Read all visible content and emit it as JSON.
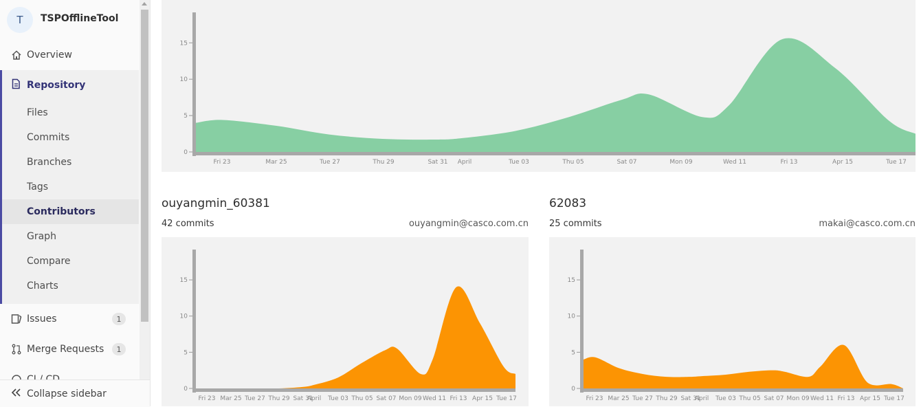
{
  "project": {
    "avatar_letter": "T",
    "name": "TSPOfflineTool"
  },
  "nav": {
    "overview": "Overview",
    "repository": "Repository",
    "repository_items": [
      "Files",
      "Commits",
      "Branches",
      "Tags",
      "Contributors",
      "Graph",
      "Compare",
      "Charts"
    ],
    "active_item": "Contributors",
    "issues": {
      "label": "Issues",
      "count": "1"
    },
    "merge_requests": {
      "label": "Merge Requests",
      "count": "1"
    },
    "cicd": "CI / CD",
    "collapse": "Collapse sidebar"
  },
  "colors": {
    "total_fill": "#87cfa3",
    "contrib_fill": "#fc9403",
    "accent": "#4b4ba3"
  },
  "chart_data": [
    {
      "type": "area",
      "title": "",
      "x_ticks": [
        "Fri 23",
        "Mar 25",
        "Tue 27",
        "Thu 29",
        "Sat 31",
        "April",
        "Tue 03",
        "Thu 05",
        "Sat 07",
        "Mon 09",
        "Wed 11",
        "Fri 13",
        "Apr 15",
        "Tue 17"
      ],
      "y_ticks": [
        "0",
        "5",
        "10",
        "15"
      ],
      "ylim": [
        0,
        19
      ],
      "x": [
        "Mar 22",
        "Mar 23",
        "Mar 25",
        "Mar 27",
        "Mar 29",
        "Mar 31",
        "Apr 01",
        "Apr 03",
        "Apr 05",
        "Apr 07",
        "Apr 08",
        "Apr 10",
        "Apr 11",
        "Apr 13",
        "Apr 15",
        "Apr 17",
        "Apr 18"
      ],
      "values": [
        4,
        4.4,
        3.6,
        2.4,
        1.8,
        1.7,
        1.9,
        2.9,
        4.8,
        7.2,
        7.9,
        4.8,
        6.4,
        15.5,
        11.5,
        4.3,
        2.5
      ]
    },
    {
      "type": "area",
      "author": "ouyangmin_60381",
      "commits": "42 commits",
      "email": "ouyangmin@casco.com.cn",
      "x_ticks": [
        "Fri 23",
        "Mar 25",
        "Tue 27",
        "Thu 29",
        "Sat 31",
        "April",
        "Tue 03",
        "Thu 05",
        "Sat 07",
        "Mon 09",
        "Wed 11",
        "Fri 13",
        "Apr 15",
        "Tue 17"
      ],
      "y_ticks": [
        "0",
        "5",
        "10",
        "15"
      ],
      "ylim": [
        0,
        19
      ],
      "x": [
        "Mar 22",
        "Mar 23",
        "Mar 25",
        "Mar 27",
        "Mar 29",
        "Mar 31",
        "Apr 01",
        "Apr 03",
        "Apr 05",
        "Apr 07",
        "Apr 08",
        "Apr 10",
        "Apr 11",
        "Apr 13",
        "Apr 15",
        "Apr 17",
        "Apr 18"
      ],
      "values": [
        0,
        0,
        0,
        0,
        0,
        0.2,
        0.5,
        1.5,
        3.5,
        5.3,
        5.5,
        2,
        4,
        14,
        9,
        3,
        2
      ]
    },
    {
      "type": "area",
      "author": "62083",
      "commits": "25 commits",
      "email": "makai@casco.com.cn",
      "x_ticks": [
        "Fri 23",
        "Mar 25",
        "Tue 27",
        "Thu 29",
        "Sat 31",
        "April",
        "Tue 03",
        "Thu 05",
        "Sat 07",
        "Mon 09",
        "Wed 11",
        "Fri 13",
        "Apr 15",
        "Tue 17"
      ],
      "y_ticks": [
        "0",
        "5",
        "10",
        "15"
      ],
      "ylim": [
        0,
        19
      ],
      "x": [
        "Mar 22",
        "Mar 23",
        "Mar 25",
        "Mar 27",
        "Mar 29",
        "Mar 31",
        "Apr 01",
        "Apr 03",
        "Apr 05",
        "Apr 07",
        "Apr 08",
        "Apr 10",
        "Apr 11",
        "Apr 13",
        "Apr 15",
        "Apr 17",
        "Apr 18"
      ],
      "values": [
        4,
        4.3,
        2.8,
        2,
        1.6,
        1.6,
        1.7,
        1.9,
        2.3,
        2.5,
        2.3,
        1.6,
        3,
        6,
        0.8,
        0.6,
        0
      ]
    }
  ]
}
